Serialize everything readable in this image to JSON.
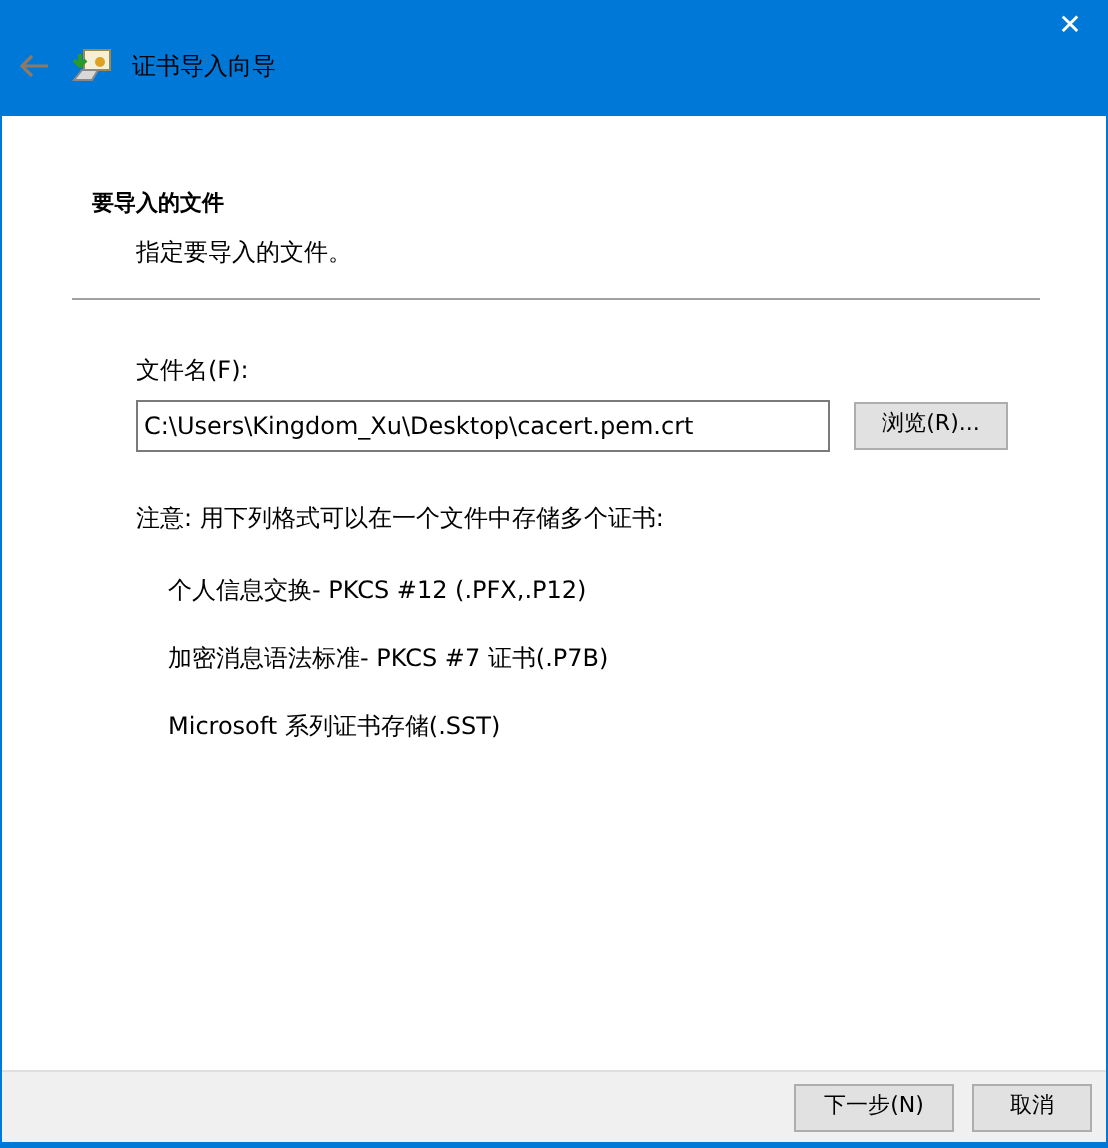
{
  "window": {
    "title": "证书导入向导",
    "close": "✕",
    "back_disabled": true
  },
  "header": {
    "title": "要导入的文件",
    "subtitle": "指定要导入的文件。"
  },
  "file": {
    "label": "文件名(F):",
    "value": "C:\\Users\\Kingdom_Xu\\Desktop\\cacert.pem.crt",
    "browse": "浏览(R)..."
  },
  "note": "注意: 用下列格式可以在一个文件中存储多个证书:",
  "formats": [
    "个人信息交换- PKCS #12 (.PFX,.P12)",
    "加密消息语法标准- PKCS #7 证书(.P7B)",
    "Microsoft 系列证书存储(.SST)"
  ],
  "buttons": [
    {
      "label": "下一步(N)",
      "kind": "next"
    },
    {
      "label": "取消",
      "kind": "cancel"
    }
  ]
}
